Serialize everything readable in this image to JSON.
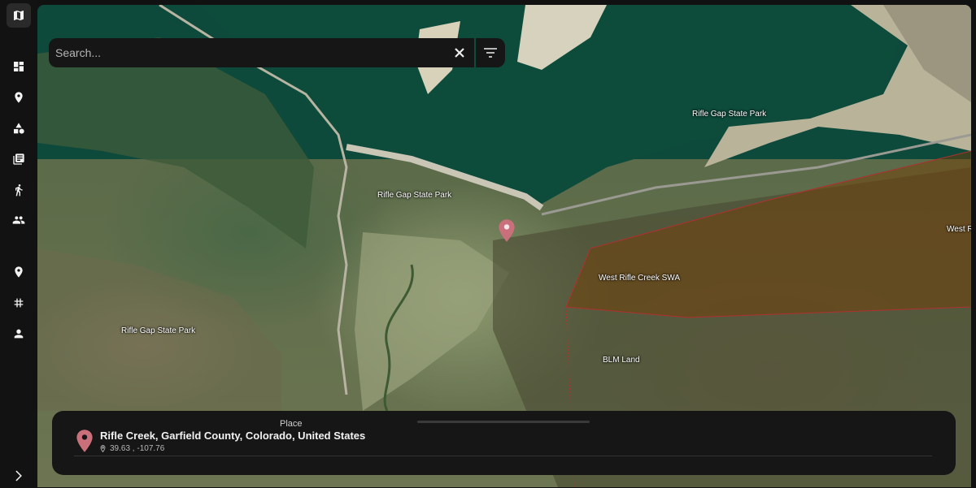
{
  "sidebar": {
    "items": [
      {
        "icon": "map-icon",
        "active": true
      },
      {
        "icon": "dashboard-icon"
      },
      {
        "icon": "location-pin-icon"
      },
      {
        "icon": "shapes-icon"
      },
      {
        "icon": "library-icon"
      },
      {
        "icon": "hiking-icon"
      },
      {
        "icon": "group-icon"
      },
      {
        "icon": "location-pin-icon"
      },
      {
        "icon": "hashtag-icon"
      },
      {
        "icon": "person-icon"
      }
    ],
    "expand_icon": "chevron-right-icon"
  },
  "search": {
    "placeholder": "Search...",
    "value": "",
    "clear_icon": "close-icon",
    "filter_icon": "filter-icon"
  },
  "map": {
    "labels": {
      "rifle_gap_lake": "Rifle Gap State Park",
      "rifle_gap_dam": "Rifle Gap State Park",
      "rifle_gap_west": "Rifle Gap State Park",
      "west_rifle_creek_swa": "West Rifle Creek SWA",
      "blm_land": "BLM Land",
      "west_edge": "West R"
    },
    "colors": {
      "water": "#0e4a3c",
      "swa_overlay": "rgba(120,60,0,0.45)",
      "swa_border": "#b03030",
      "pin": "#c9707a"
    }
  },
  "place_sheet": {
    "header": "Place",
    "name": "Rifle Creek, Garfield County, Colorado, United States",
    "coordinates": "39.63 , -107.76"
  }
}
